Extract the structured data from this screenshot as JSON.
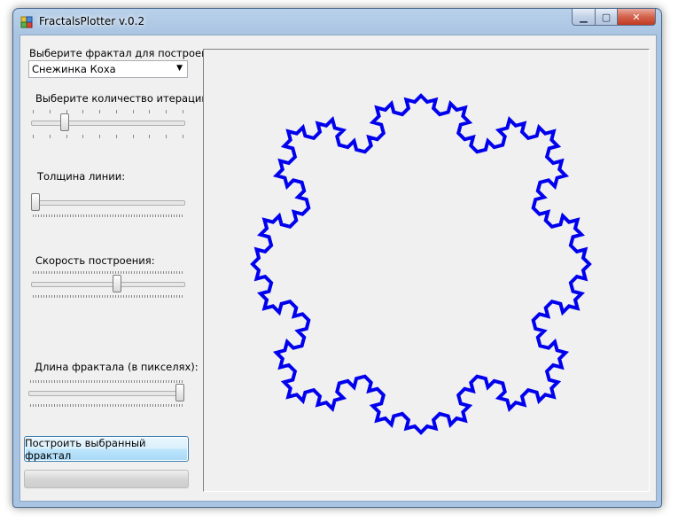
{
  "window": {
    "title": "FractalsPlotter v.0.2"
  },
  "fractal_select": {
    "label": "Выберите фрактал для построения",
    "selected": "Снежинка Коха"
  },
  "iterations": {
    "label": "Выберите количество итераций:",
    "value_fraction": 0.2
  },
  "line_width": {
    "label": "Толщина линии:",
    "value_fraction": 0.0
  },
  "speed": {
    "label": "Скорость построения:",
    "value_fraction": 0.56
  },
  "length": {
    "label": "Длина фрактала (в пикселях):",
    "value_fraction": 1.0
  },
  "build_button": {
    "label": "Построить выбранный фрактал"
  },
  "progress": {
    "value_fraction": 0.0
  },
  "plot": {
    "fractal": "Koch snowflake",
    "iterations": 3,
    "stroke_color": "#0000ee"
  },
  "icons": {
    "app": "app-icon",
    "minimize": "minimize-icon",
    "maximize": "maximize-icon",
    "close": "close-icon",
    "dropdown": "chevron-down-icon"
  }
}
